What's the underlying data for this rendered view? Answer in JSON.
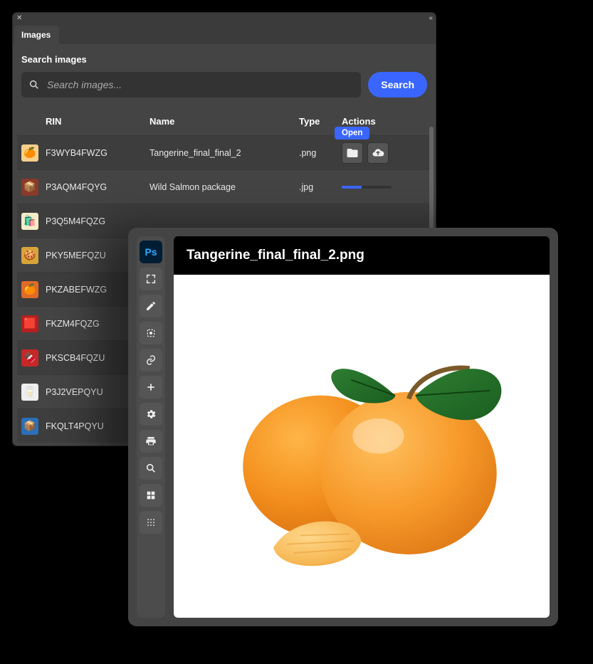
{
  "panel": {
    "tab_label": "Images",
    "section_label": "Search images",
    "search_placeholder": "Search images...",
    "search_button": "Search",
    "columns": {
      "rin": "RIN",
      "name": "Name",
      "type": "Type",
      "actions": "Actions"
    },
    "tooltip_open": "Open",
    "rows": [
      {
        "rin": "F3WYB4FWZG",
        "name": "Tangerine_final_final_2",
        "type": ".png",
        "thumb_bg": "#f7d08a",
        "thumb_emoji": "🍊",
        "mode": "actions"
      },
      {
        "rin": "P3AQM4FQYG",
        "name": "Wild Salmon package",
        "type": ".jpg",
        "thumb_bg": "#8a3a2a",
        "thumb_emoji": "📦",
        "mode": "progress"
      },
      {
        "rin": "P3Q5M4FQZG",
        "name": "",
        "type": "",
        "thumb_bg": "#f3ecc7",
        "thumb_emoji": "🛍️",
        "mode": "none"
      },
      {
        "rin": "PKY5MEFQZU",
        "name": "",
        "type": "",
        "thumb_bg": "#d8a53a",
        "thumb_emoji": "🍪",
        "mode": "none"
      },
      {
        "rin": "PKZABEFWZG",
        "name": "",
        "type": "",
        "thumb_bg": "#e06a2a",
        "thumb_emoji": "🍊",
        "mode": "none"
      },
      {
        "rin": "FKZM4FQZG",
        "name": "",
        "type": "",
        "thumb_bg": "#b81f1f",
        "thumb_emoji": "🟥",
        "mode": "none"
      },
      {
        "rin": "PKSCB4FQZU",
        "name": "",
        "type": "",
        "thumb_bg": "#c62828",
        "thumb_emoji": "🍫",
        "mode": "none"
      },
      {
        "rin": "P3J2VEPQYU",
        "name": "",
        "type": "",
        "thumb_bg": "#eee",
        "thumb_emoji": "🥛",
        "mode": "none"
      },
      {
        "rin": "FKQLT4PQYU",
        "name": "",
        "type": "",
        "thumb_bg": "#2a6fb8",
        "thumb_emoji": "📦",
        "mode": "none"
      }
    ]
  },
  "viewer": {
    "title": "Tangerine_final_final_2.png",
    "toolbar": [
      {
        "id": "photoshop",
        "label": "Ps"
      },
      {
        "id": "expand",
        "label": "expand-icon"
      },
      {
        "id": "edit",
        "label": "pencil-icon"
      },
      {
        "id": "crop",
        "label": "crop-icon"
      },
      {
        "id": "link",
        "label": "link-icon"
      },
      {
        "id": "add",
        "label": "plus-icon"
      },
      {
        "id": "settings",
        "label": "gear-icon"
      },
      {
        "id": "print",
        "label": "print-icon"
      },
      {
        "id": "search",
        "label": "search-icon"
      },
      {
        "id": "grid-large",
        "label": "grid-large-icon"
      },
      {
        "id": "grid-small",
        "label": "grid-small-icon"
      }
    ]
  }
}
